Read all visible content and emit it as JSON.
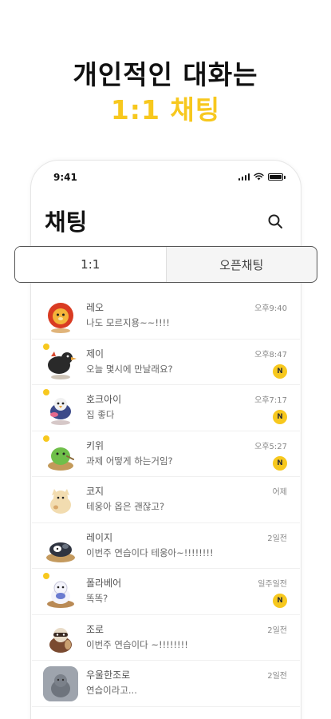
{
  "headline": {
    "line1": "개인적인 대화는",
    "line2": "1:1 채팅"
  },
  "status_bar": {
    "time": "9:41"
  },
  "header": {
    "title": "채팅"
  },
  "tabs": [
    {
      "label": "1:1",
      "active": true
    },
    {
      "label": "오픈채팅",
      "active": false
    }
  ],
  "colors": {
    "accent": "#f7c81e",
    "text": "#222222"
  },
  "chats": [
    {
      "name": "레오",
      "preview": "나도 모르지용~~!!!!",
      "time": "오후9:40",
      "badge": "",
      "online": false,
      "avatar": "lion-avatar"
    },
    {
      "name": "제이",
      "preview": "오늘 몇시에 만날래요?",
      "time": "오후8:47",
      "badge": "N",
      "online": true,
      "avatar": "crow-avatar"
    },
    {
      "name": "호크아이",
      "preview": "집 좋다",
      "time": "오후7:17",
      "badge": "N",
      "online": true,
      "avatar": "bird-avatar"
    },
    {
      "name": "키위",
      "preview": "과제 어떻게 하는거임?",
      "time": "오후5:27",
      "badge": "N",
      "online": true,
      "avatar": "kiwi-avatar"
    },
    {
      "name": "코지",
      "preview": "테웅아 옵은 괜잖고?",
      "time": "어제",
      "badge": "",
      "online": false,
      "avatar": "cat-avatar"
    },
    {
      "name": "레이지",
      "preview": "이번주 연습이다 테웅아~!!!!!!!!",
      "time": "2일전",
      "badge": "",
      "online": false,
      "avatar": "sloth-avatar"
    },
    {
      "name": "폴라베어",
      "preview": "똑똑?",
      "time": "일주일전",
      "badge": "N",
      "online": true,
      "avatar": "bear-avatar"
    },
    {
      "name": "조로",
      "preview": "이번주 연습이다 ~!!!!!!!!",
      "time": "2일전",
      "badge": "",
      "online": false,
      "avatar": "raccoon-avatar"
    },
    {
      "name": "우울한조로",
      "preview": "연습이라고...",
      "time": "2일전",
      "badge": "",
      "online": false,
      "avatar": "gray-avatar"
    }
  ]
}
